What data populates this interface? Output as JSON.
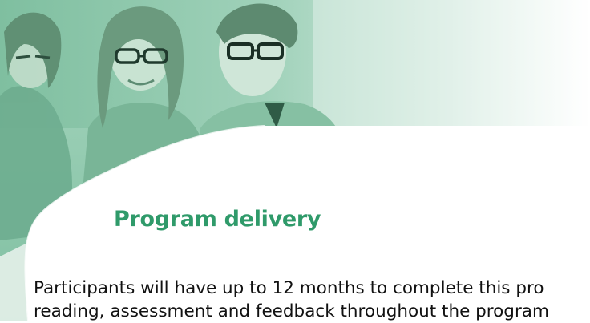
{
  "colors": {
    "accent": "#2f9a6a",
    "banner_tint": "#cde7d8",
    "text": "#111111"
  },
  "header_image": {
    "icon": "business-team-photo"
  },
  "section": {
    "heading": "Program delivery",
    "paragraph_lines": [
      "Participants will have up to 12 months to complete this pro",
      "reading, assessment and feedback throughout the program"
    ]
  }
}
